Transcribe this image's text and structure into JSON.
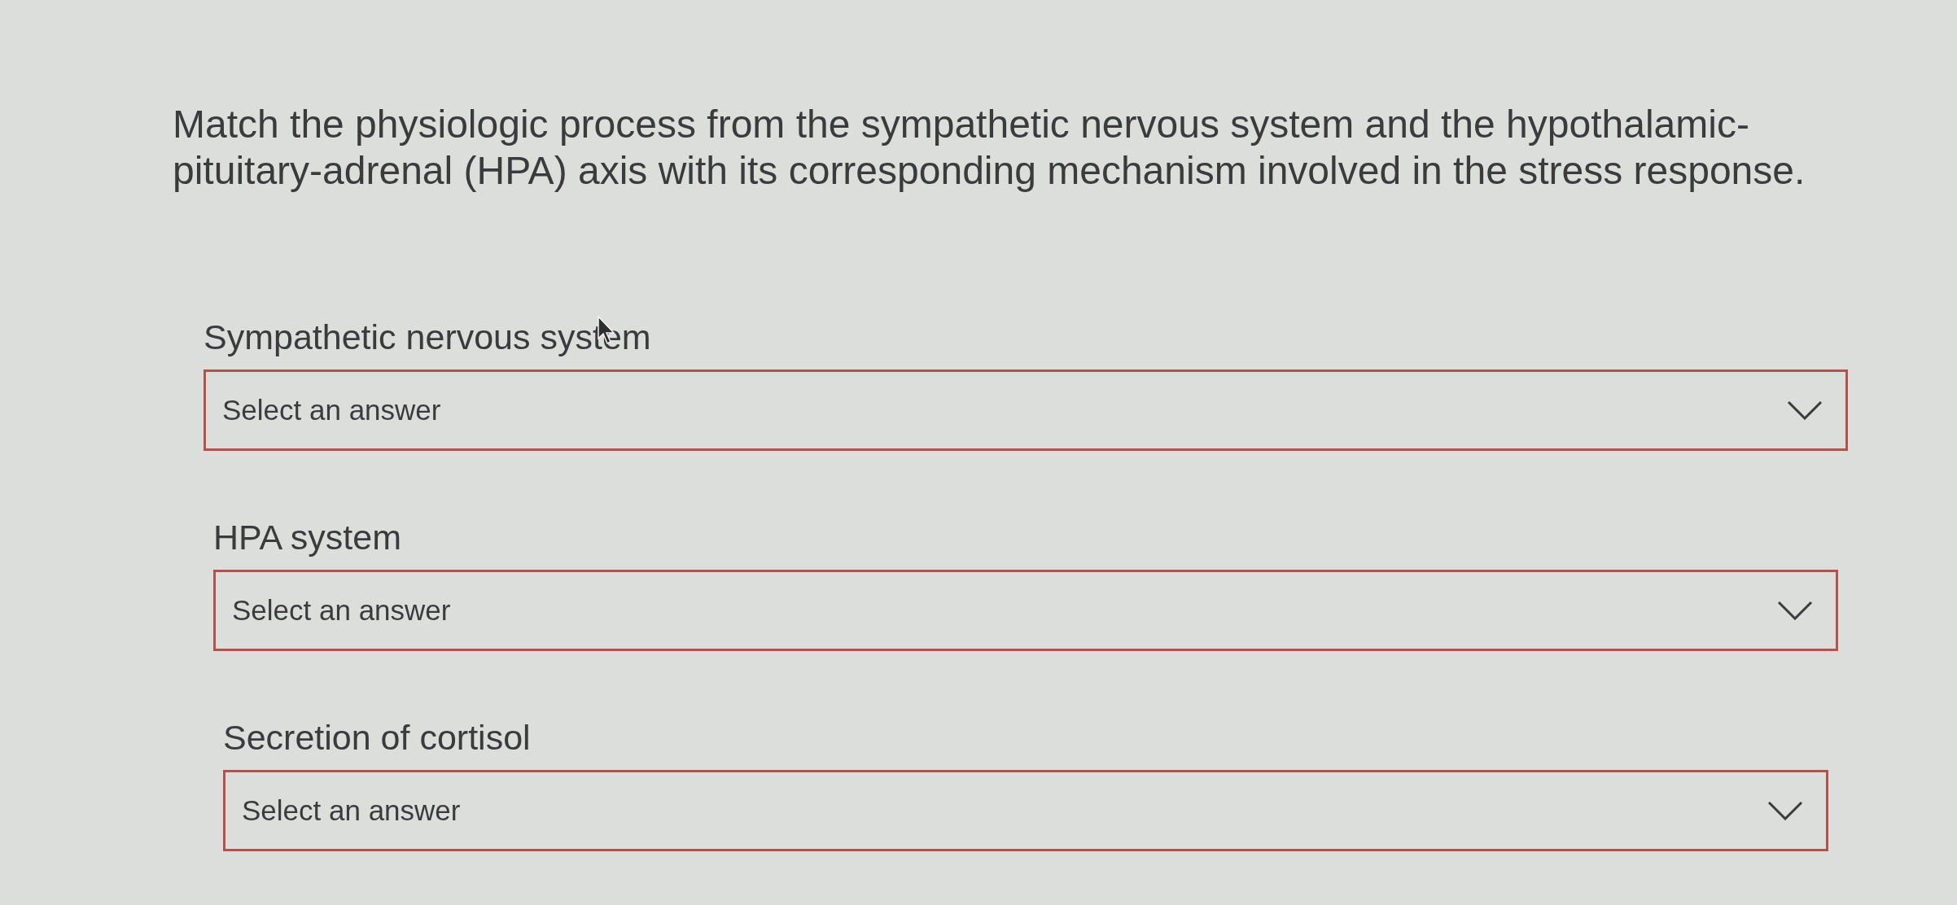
{
  "question": "Match the physiologic process from the sympathetic nervous system and the hypothalamic-pituitary-adrenal (HPA) axis with its corresponding mechanism involved in the stress response.",
  "items": [
    {
      "label": "Sympathetic nervous system",
      "dropdown": {
        "placeholder": "Select an answer",
        "invalid": true
      }
    },
    {
      "label": "HPA system",
      "dropdown": {
        "placeholder": "Select an answer",
        "invalid": true
      }
    },
    {
      "label": "Secretion of cortisol",
      "dropdown": {
        "placeholder": "Select an answer",
        "invalid": true
      }
    }
  ]
}
